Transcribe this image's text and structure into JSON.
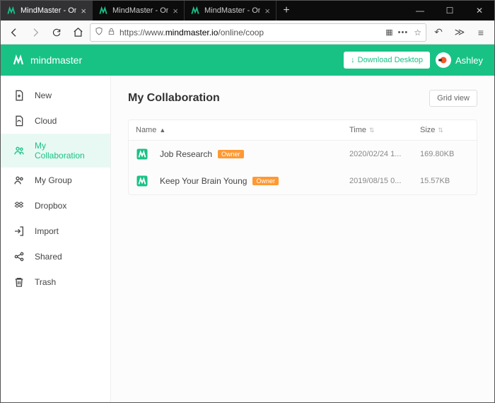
{
  "browser": {
    "tabs": [
      {
        "label": "MindMaster - Online Mind M"
      },
      {
        "label": "MindMaster - Online Mind M"
      },
      {
        "label": "MindMaster - Online Mind M"
      }
    ],
    "url_prefix": "https://www.",
    "url_domain": "mindmaster.io",
    "url_path": "/online/coop"
  },
  "header": {
    "brand": "mindmaster",
    "download": "Download Desktop",
    "user": "Ashley"
  },
  "sidebar": {
    "items": [
      {
        "label": "New"
      },
      {
        "label": "Cloud"
      },
      {
        "label": "My Collaboration"
      },
      {
        "label": "My Group"
      },
      {
        "label": "Dropbox"
      },
      {
        "label": "Import"
      },
      {
        "label": "Shared"
      },
      {
        "label": "Trash"
      }
    ]
  },
  "main": {
    "title": "My Collaboration",
    "grid_view": "Grid view",
    "columns": {
      "name": "Name",
      "time": "Time",
      "size": "Size"
    },
    "rows": [
      {
        "name": "Job Research",
        "badge": "Owner",
        "time": "2020/02/24 1...",
        "size": "169.80KB"
      },
      {
        "name": "Keep Your Brain Young",
        "badge": "Owner",
        "time": "2019/08/15 0...",
        "size": "15.57KB"
      }
    ]
  }
}
